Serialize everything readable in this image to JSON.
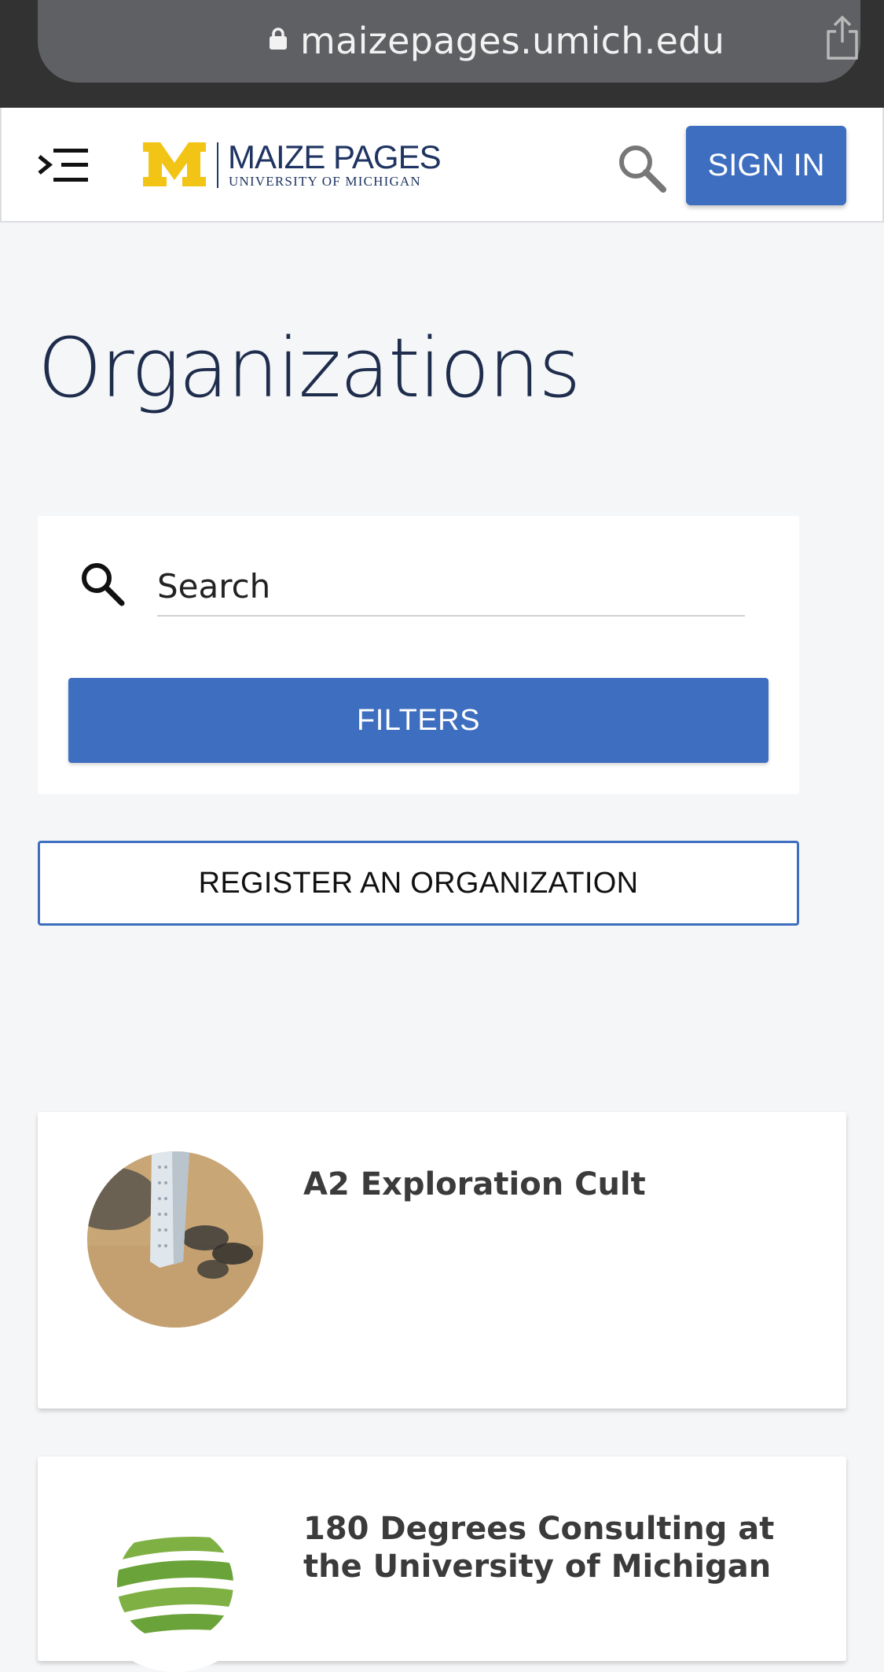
{
  "browser": {
    "url": "maizepages.umich.edu",
    "icons": [
      "lock-icon",
      "share-icon"
    ]
  },
  "header": {
    "logo_title": "MAIZE PAGES",
    "logo_subtitle": "UNIVERSITY OF MICHIGAN",
    "signin_label": "SIGN IN",
    "icons": [
      "menu-icon",
      "search-icon"
    ],
    "colors": {
      "brand_blue": "#3d6ebf",
      "maize": "#f2c416",
      "navy": "#1f3462"
    }
  },
  "page": {
    "title": "Organizations"
  },
  "search": {
    "placeholder": "Search",
    "filters_label": "FILTERS"
  },
  "register_label": "REGISTER AN ORGANIZATION",
  "organizations": [
    {
      "name": "A2 Exploration Cult"
    },
    {
      "name": "180 Degrees Consulting at the University of Michigan"
    }
  ]
}
